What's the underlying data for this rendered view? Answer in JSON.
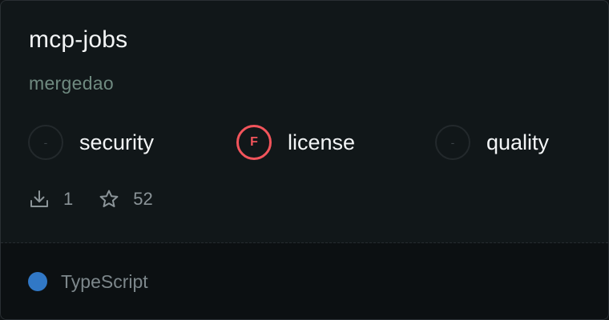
{
  "package": {
    "name": "mcp-jobs",
    "owner": "mergedao"
  },
  "scores": [
    {
      "label": "security",
      "grade": "-",
      "status": "none"
    },
    {
      "label": "license",
      "grade": "F",
      "status": "fail"
    },
    {
      "label": "quality",
      "grade": "-",
      "status": "none"
    }
  ],
  "stats": {
    "downloads": "1",
    "stars": "52",
    "download_icon": "download-icon",
    "star_icon": "star-icon"
  },
  "language": {
    "name": "TypeScript",
    "color": "#3178c6"
  },
  "colors": {
    "fail": "#f2545b",
    "owner": "#6f8a80"
  }
}
